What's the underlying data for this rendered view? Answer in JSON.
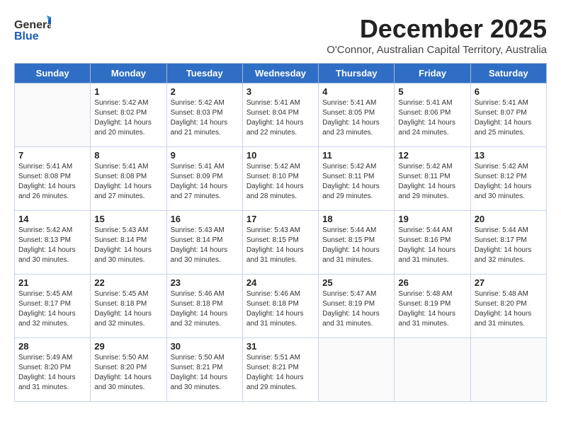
{
  "header": {
    "logo_general": "General",
    "logo_blue": "Blue",
    "month_title": "December 2025",
    "location": "O'Connor, Australian Capital Territory, Australia"
  },
  "weekdays": [
    "Sunday",
    "Monday",
    "Tuesday",
    "Wednesday",
    "Thursday",
    "Friday",
    "Saturday"
  ],
  "weeks": [
    [
      {
        "day": "",
        "info": ""
      },
      {
        "day": "1",
        "info": "Sunrise: 5:42 AM\nSunset: 8:02 PM\nDaylight: 14 hours\nand 20 minutes."
      },
      {
        "day": "2",
        "info": "Sunrise: 5:42 AM\nSunset: 8:03 PM\nDaylight: 14 hours\nand 21 minutes."
      },
      {
        "day": "3",
        "info": "Sunrise: 5:41 AM\nSunset: 8:04 PM\nDaylight: 14 hours\nand 22 minutes."
      },
      {
        "day": "4",
        "info": "Sunrise: 5:41 AM\nSunset: 8:05 PM\nDaylight: 14 hours\nand 23 minutes."
      },
      {
        "day": "5",
        "info": "Sunrise: 5:41 AM\nSunset: 8:06 PM\nDaylight: 14 hours\nand 24 minutes."
      },
      {
        "day": "6",
        "info": "Sunrise: 5:41 AM\nSunset: 8:07 PM\nDaylight: 14 hours\nand 25 minutes."
      }
    ],
    [
      {
        "day": "7",
        "info": "Sunrise: 5:41 AM\nSunset: 8:08 PM\nDaylight: 14 hours\nand 26 minutes."
      },
      {
        "day": "8",
        "info": "Sunrise: 5:41 AM\nSunset: 8:08 PM\nDaylight: 14 hours\nand 27 minutes."
      },
      {
        "day": "9",
        "info": "Sunrise: 5:41 AM\nSunset: 8:09 PM\nDaylight: 14 hours\nand 27 minutes."
      },
      {
        "day": "10",
        "info": "Sunrise: 5:42 AM\nSunset: 8:10 PM\nDaylight: 14 hours\nand 28 minutes."
      },
      {
        "day": "11",
        "info": "Sunrise: 5:42 AM\nSunset: 8:11 PM\nDaylight: 14 hours\nand 29 minutes."
      },
      {
        "day": "12",
        "info": "Sunrise: 5:42 AM\nSunset: 8:11 PM\nDaylight: 14 hours\nand 29 minutes."
      },
      {
        "day": "13",
        "info": "Sunrise: 5:42 AM\nSunset: 8:12 PM\nDaylight: 14 hours\nand 30 minutes."
      }
    ],
    [
      {
        "day": "14",
        "info": "Sunrise: 5:42 AM\nSunset: 8:13 PM\nDaylight: 14 hours\nand 30 minutes."
      },
      {
        "day": "15",
        "info": "Sunrise: 5:43 AM\nSunset: 8:14 PM\nDaylight: 14 hours\nand 30 minutes."
      },
      {
        "day": "16",
        "info": "Sunrise: 5:43 AM\nSunset: 8:14 PM\nDaylight: 14 hours\nand 30 minutes."
      },
      {
        "day": "17",
        "info": "Sunrise: 5:43 AM\nSunset: 8:15 PM\nDaylight: 14 hours\nand 31 minutes."
      },
      {
        "day": "18",
        "info": "Sunrise: 5:44 AM\nSunset: 8:15 PM\nDaylight: 14 hours\nand 31 minutes."
      },
      {
        "day": "19",
        "info": "Sunrise: 5:44 AM\nSunset: 8:16 PM\nDaylight: 14 hours\nand 31 minutes."
      },
      {
        "day": "20",
        "info": "Sunrise: 5:44 AM\nSunset: 8:17 PM\nDaylight: 14 hours\nand 32 minutes."
      }
    ],
    [
      {
        "day": "21",
        "info": "Sunrise: 5:45 AM\nSunset: 8:17 PM\nDaylight: 14 hours\nand 32 minutes."
      },
      {
        "day": "22",
        "info": "Sunrise: 5:45 AM\nSunset: 8:18 PM\nDaylight: 14 hours\nand 32 minutes."
      },
      {
        "day": "23",
        "info": "Sunrise: 5:46 AM\nSunset: 8:18 PM\nDaylight: 14 hours\nand 32 minutes."
      },
      {
        "day": "24",
        "info": "Sunrise: 5:46 AM\nSunset: 8:18 PM\nDaylight: 14 hours\nand 31 minutes."
      },
      {
        "day": "25",
        "info": "Sunrise: 5:47 AM\nSunset: 8:19 PM\nDaylight: 14 hours\nand 31 minutes."
      },
      {
        "day": "26",
        "info": "Sunrise: 5:48 AM\nSunset: 8:19 PM\nDaylight: 14 hours\nand 31 minutes."
      },
      {
        "day": "27",
        "info": "Sunrise: 5:48 AM\nSunset: 8:20 PM\nDaylight: 14 hours\nand 31 minutes."
      }
    ],
    [
      {
        "day": "28",
        "info": "Sunrise: 5:49 AM\nSunset: 8:20 PM\nDaylight: 14 hours\nand 31 minutes."
      },
      {
        "day": "29",
        "info": "Sunrise: 5:50 AM\nSunset: 8:20 PM\nDaylight: 14 hours\nand 30 minutes."
      },
      {
        "day": "30",
        "info": "Sunrise: 5:50 AM\nSunset: 8:21 PM\nDaylight: 14 hours\nand 30 minutes."
      },
      {
        "day": "31",
        "info": "Sunrise: 5:51 AM\nSunset: 8:21 PM\nDaylight: 14 hours\nand 29 minutes."
      },
      {
        "day": "",
        "info": ""
      },
      {
        "day": "",
        "info": ""
      },
      {
        "day": "",
        "info": ""
      }
    ]
  ]
}
